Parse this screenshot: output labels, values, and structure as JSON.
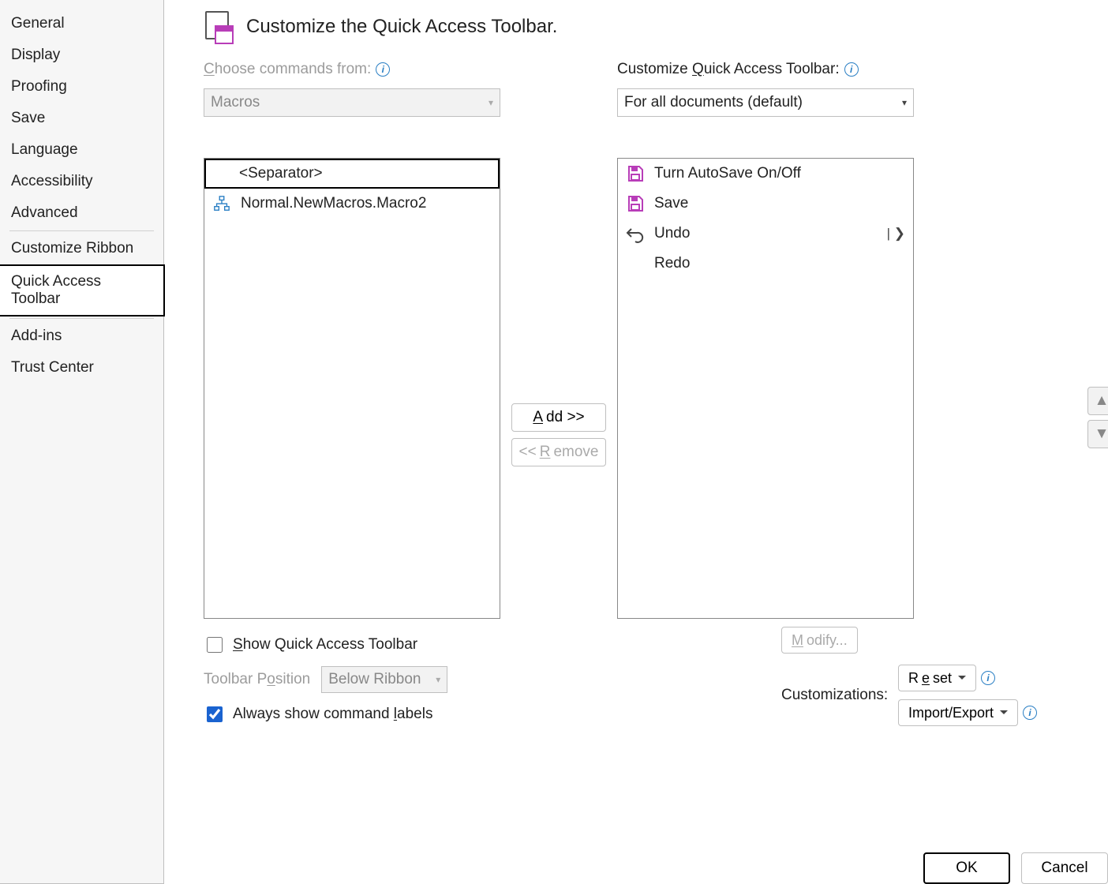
{
  "sidebar": {
    "items": [
      "General",
      "Display",
      "Proofing",
      "Save",
      "Language",
      "Accessibility",
      "Advanced",
      "Customize Ribbon",
      "Quick Access Toolbar",
      "Add-ins",
      "Trust Center"
    ],
    "selected_index": 8,
    "separators_after": [
      6,
      8
    ]
  },
  "header": {
    "title": "Customize the Quick Access Toolbar."
  },
  "left": {
    "label_pre": "C",
    "label_rest": "hoose commands from:",
    "combo_value": "Macros",
    "list": [
      {
        "text": "<Separator>",
        "icon": "none",
        "selected": true
      },
      {
        "text": "Normal.NewMacros.Macro2",
        "icon": "macro",
        "selected": false
      }
    ],
    "show_qat_label_pre": "S",
    "show_qat_label_rest": "how Quick Access Toolbar",
    "show_qat_checked": false,
    "toolbar_pos_label_pre": "Toolbar P",
    "toolbar_pos_label_ul": "o",
    "toolbar_pos_label_rest": "sition",
    "toolbar_pos_value": "Below Ribbon",
    "always_labels_pre": "Always show command ",
    "always_labels_ul": "l",
    "always_labels_rest": "abels",
    "always_labels_checked": true
  },
  "mid": {
    "add_pre": "A",
    "add_rest": "dd >>",
    "remove_pre": "<< ",
    "remove_ul": "R",
    "remove_rest": "emove"
  },
  "right": {
    "label_pre": "Customize ",
    "label_ul": "Q",
    "label_rest": "uick Access Toolbar:",
    "combo_value": "For all documents (default)",
    "list": [
      {
        "text": "Turn AutoSave On/Off",
        "icon": "autosave",
        "right": ""
      },
      {
        "text": "Save",
        "icon": "save",
        "right": ""
      },
      {
        "text": "Undo",
        "icon": "undo",
        "right": "| ❯"
      },
      {
        "text": "Redo",
        "icon": "none",
        "right": ""
      }
    ],
    "modify_pre": "M",
    "modify_rest": "odify...",
    "customizations_label": "Customizations:",
    "reset_pre": "R",
    "reset_ul": "e",
    "reset_rest": "set",
    "importexport_label": "Import/Export"
  },
  "footer": {
    "ok": "OK",
    "cancel": "Cancel"
  }
}
